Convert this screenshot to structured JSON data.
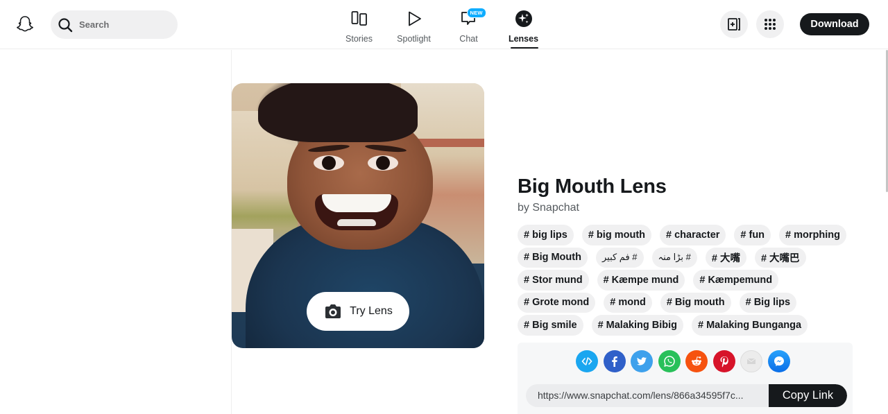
{
  "header": {
    "logo_icon": "snapchat-ghost-icon",
    "search": {
      "placeholder": "Search",
      "icon": "search-icon"
    },
    "nav": [
      {
        "label": "Stories",
        "icon": "stories-icon",
        "active": false
      },
      {
        "label": "Spotlight",
        "icon": "play-icon",
        "active": false
      },
      {
        "label": "Chat",
        "icon": "chat-icon",
        "active": false,
        "badge": "NEW"
      },
      {
        "label": "Lenses",
        "icon": "lenses-sparkle-icon",
        "active": true
      }
    ],
    "create_icon": "add-lens-icon",
    "apps_icon": "apps-grid-icon",
    "download_label": "Download"
  },
  "lens": {
    "preview_alt": "Big Mouth Lens preview",
    "try_label": "Try Lens",
    "title": "Big Mouth Lens",
    "byline": "by Snapchat",
    "tags": [
      "# big lips",
      "# big mouth",
      "# character",
      "# fun",
      "# morphing",
      "# Big Mouth",
      "# فم كبير",
      "# بڑا منہ",
      "# 大嘴",
      "# 大嘴巴",
      "# Stor mund",
      "# Kæmpe mund",
      "# Kæmpemund",
      "# Grote mond",
      "# mond",
      "# Big mouth",
      "# Big lips",
      "# Big smile",
      "# Malaking Bibig",
      "# Malaking Bunganga"
    ]
  },
  "share": {
    "icons": [
      {
        "name": "embed",
        "color": "#1aa6f0"
      },
      {
        "name": "facebook",
        "color": "#3060c9"
      },
      {
        "name": "twitter",
        "color": "#3ea1ec"
      },
      {
        "name": "whatsapp",
        "color": "#29c05a"
      },
      {
        "name": "reddit",
        "color": "#f6520f"
      },
      {
        "name": "pinterest",
        "color": "#d7142a"
      },
      {
        "name": "email",
        "color": "#ececec"
      },
      {
        "name": "messenger",
        "color": "#1c8cf5"
      }
    ],
    "url": "https://www.snapchat.com/lens/866a34595f7c...",
    "copy_label": "Copy Link"
  }
}
